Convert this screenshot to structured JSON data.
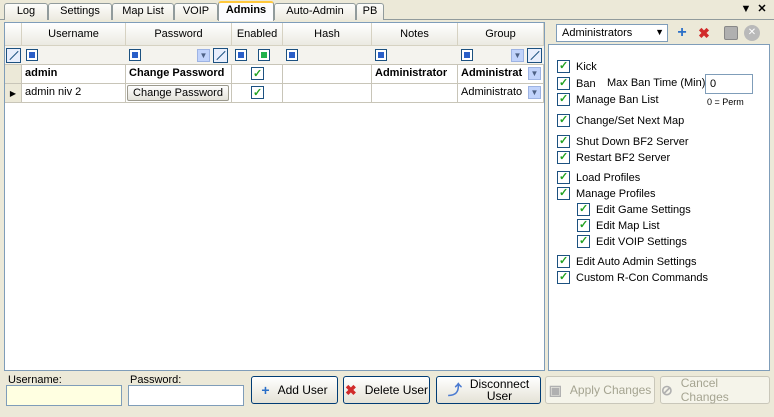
{
  "tabs": [
    "Log",
    "Settings",
    "Map List",
    "VOIP",
    "Admins",
    "Auto-Admin",
    "PB"
  ],
  "active_tab": "Admins",
  "window_controls": {
    "pin": "▼",
    "close": "✕"
  },
  "grid": {
    "columns": [
      "Username",
      "Password",
      "Enabled",
      "Hash",
      "Notes",
      "Group"
    ],
    "rows": [
      {
        "username": "admin",
        "password": "Change Password",
        "enabled": true,
        "hash": "",
        "notes": "Administrator",
        "group": "Administrat",
        "bold": true
      },
      {
        "username": "admin niv 2",
        "password": "Change Password",
        "enabled": true,
        "hash": "",
        "notes": "",
        "group": "Administrato",
        "bold": false
      }
    ]
  },
  "group_panel": {
    "selected_group": "Administrators",
    "permissions": {
      "kick": "Kick",
      "ban": "Ban",
      "max_ban_label": "Max Ban Time (Min):",
      "max_ban_value": "0",
      "perm_note": "0 = Perm",
      "manage_ban_list": "Manage Ban List",
      "change_next_map": "Change/Set Next Map",
      "shutdown": "Shut Down BF2 Server",
      "restart": "Restart BF2 Server",
      "load_profiles": "Load Profiles",
      "manage_profiles": "Manage Profiles",
      "edit_game": "Edit Game Settings",
      "edit_map": "Edit Map List",
      "edit_voip": "Edit VOIP Settings",
      "edit_auto_admin": "Edit Auto Admin Settings",
      "custom_rcon": "Custom R-Con Commands"
    }
  },
  "bottom": {
    "username_label": "Username:",
    "username_value": "",
    "password_label": "Password:",
    "password_value": "",
    "add_user": "Add User",
    "delete_user": "Delete User",
    "disconnect_user_1": "Disconnect",
    "disconnect_user_2": "User",
    "apply_changes": "Apply Changes",
    "cancel_changes": "Cancel Changes"
  }
}
